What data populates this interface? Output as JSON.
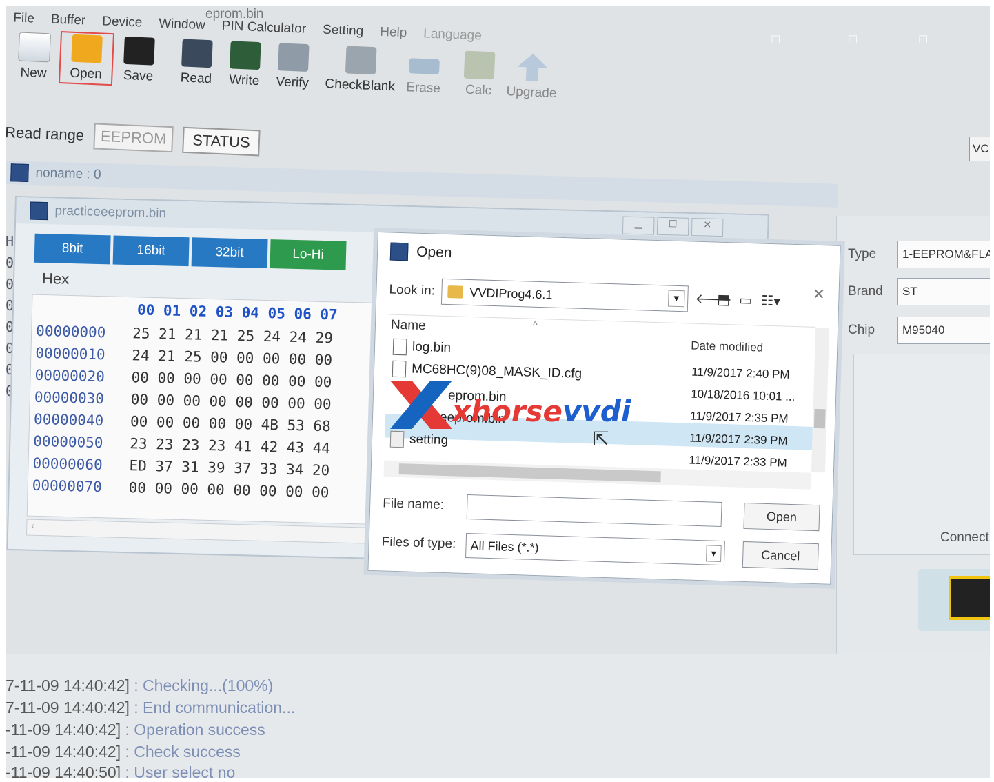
{
  "window": {
    "title": "eprom.bin"
  },
  "menu": [
    "File",
    "Buffer",
    "Device",
    "Window",
    "PIN Calculator",
    "Setting",
    "Help",
    "Language"
  ],
  "toolbar": {
    "new": "New",
    "open": "Open",
    "save": "Save",
    "read": "Read",
    "write": "Write",
    "verify": "Verify",
    "checkblank": "CheckBlank",
    "erase": "Erase",
    "calc": "Calc",
    "upgrade": "Upgrade"
  },
  "read_range": {
    "label": "Read range",
    "eeprom": "EEPROM",
    "status": "STATUS"
  },
  "noname_tab": "noname : 0",
  "hex_window": {
    "title": "practiceeeprom.bin",
    "modes": [
      "8bit",
      "16bit",
      "32bit",
      "Lo-Hi"
    ],
    "hex_label": "Hex",
    "header": "00 01 02 03 04 05 06 07",
    "rows": [
      {
        "addr": "00000000",
        "bytes": "25 21 21 21 25 24 24 29"
      },
      {
        "addr": "00000010",
        "bytes": "24 21 25 00 00 00 00 00"
      },
      {
        "addr": "00000020",
        "bytes": "00 00 00 00 00 00 00 00"
      },
      {
        "addr": "00000030",
        "bytes": "00 00 00 00 00 00 00 00"
      },
      {
        "addr": "00000040",
        "bytes": "00 00 00 00 00 4B 53 68"
      },
      {
        "addr": "00000050",
        "bytes": "23 23 23 23 41 42 43 44"
      },
      {
        "addr": "00000060",
        "bytes": "ED 37 31 39 37 33 34 20"
      },
      {
        "addr": "00000070",
        "bytes": "00 00 00 00 00 00 00 00"
      }
    ]
  },
  "open_dialog": {
    "title": "Open",
    "look_in_label": "Look in:",
    "look_in_value": "VVDIProg4.6.1",
    "name_col": "Name",
    "date_col": "Date modified",
    "files": [
      {
        "name": "log.bin",
        "date": "11/9/2017 2:40 PM"
      },
      {
        "name": "MC68HC(9)08_MASK_ID.cfg",
        "date": "10/18/2016 10:01 ..."
      },
      {
        "name": "eprom.bin",
        "date": "11/9/2017 2:35 PM"
      },
      {
        "name": "ticeeprom.bin",
        "date": "11/9/2017 2:39 PM"
      },
      {
        "name": "setting",
        "date": "11/9/2017 2:33 PM"
      }
    ],
    "file_name_label": "File name:",
    "file_name_value": "",
    "file_type_label": "Files of type:",
    "file_type_value": "All Files (*.*)",
    "open_btn": "Open",
    "cancel_btn": "Cancel"
  },
  "right_panel": {
    "type_label": "Type",
    "type_value": "1-EEPROM&FLA",
    "brand_label": "Brand",
    "brand_value": "ST",
    "chip_label": "Chip",
    "chip_value": "M95040",
    "connect": "Connect",
    "vc": "VC"
  },
  "watermark": {
    "red": "xhorse",
    "blue": "vvdi"
  },
  "log": [
    {
      "ts": "7-11-09 14:40:42]",
      "msg": ": Checking...(100%)"
    },
    {
      "ts": "7-11-09 14:40:42]",
      "msg": ": End communication..."
    },
    {
      "ts": "-11-09 14:40:42]",
      "msg": ": Operation success"
    },
    {
      "ts": "-11-09 14:40:42]",
      "msg": ": Check success"
    },
    {
      "ts": "-11-09 14:40:50]",
      "msg": ": User select no"
    }
  ]
}
